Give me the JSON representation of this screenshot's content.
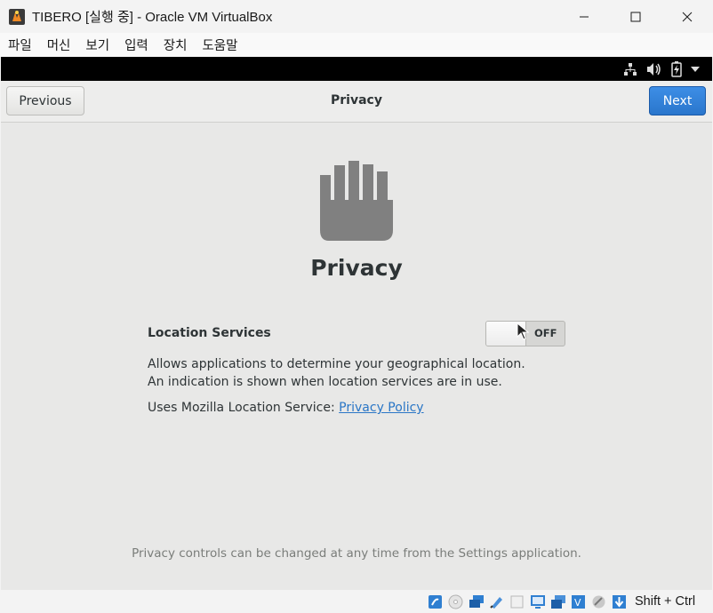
{
  "window": {
    "title": "TIBERO [실행 중] - Oracle VM VirtualBox",
    "controls": [
      "minimize-icon",
      "maximize-icon",
      "close-icon"
    ]
  },
  "menubar": {
    "items": [
      {
        "label": "파일"
      },
      {
        "label": "머신"
      },
      {
        "label": "보기"
      },
      {
        "label": "입력"
      },
      {
        "label": "장치"
      },
      {
        "label": "도움말"
      }
    ]
  },
  "guest_topbar": {
    "icons": [
      "network-icon",
      "volume-icon",
      "battery-icon",
      "dropdown-arrow-icon"
    ]
  },
  "setup": {
    "previous_label": "Previous",
    "header_title": "Privacy",
    "next_label": "Next",
    "page_title": "Privacy",
    "icon": "hand-icon",
    "location_services": {
      "label": "Location Services",
      "toggle_state": "OFF",
      "description": "Allows applications to determine your geographical location. An indication is shown when location services are in use."
    },
    "uses_text": "Uses Mozilla Location Service:",
    "policy_link": "Privacy Policy",
    "footer_note": "Privacy controls can be changed at any time from the Settings application."
  },
  "statusbar": {
    "icons": [
      "hard-disk-icon",
      "optical-disk-icon",
      "network-adapter-icon",
      "usb-icon",
      "shared-folder-icon",
      "display-icon",
      "video-capture-icon",
      "virtualization-icon",
      "mouse-integration-icon",
      "keyboard-capture-icon"
    ],
    "host_key": "Shift + Ctrl"
  },
  "colors": {
    "accent": "#2a76cc",
    "link": "#2a76c6",
    "guest_background": "#e8e8e7",
    "icon_gray": "#808080"
  }
}
